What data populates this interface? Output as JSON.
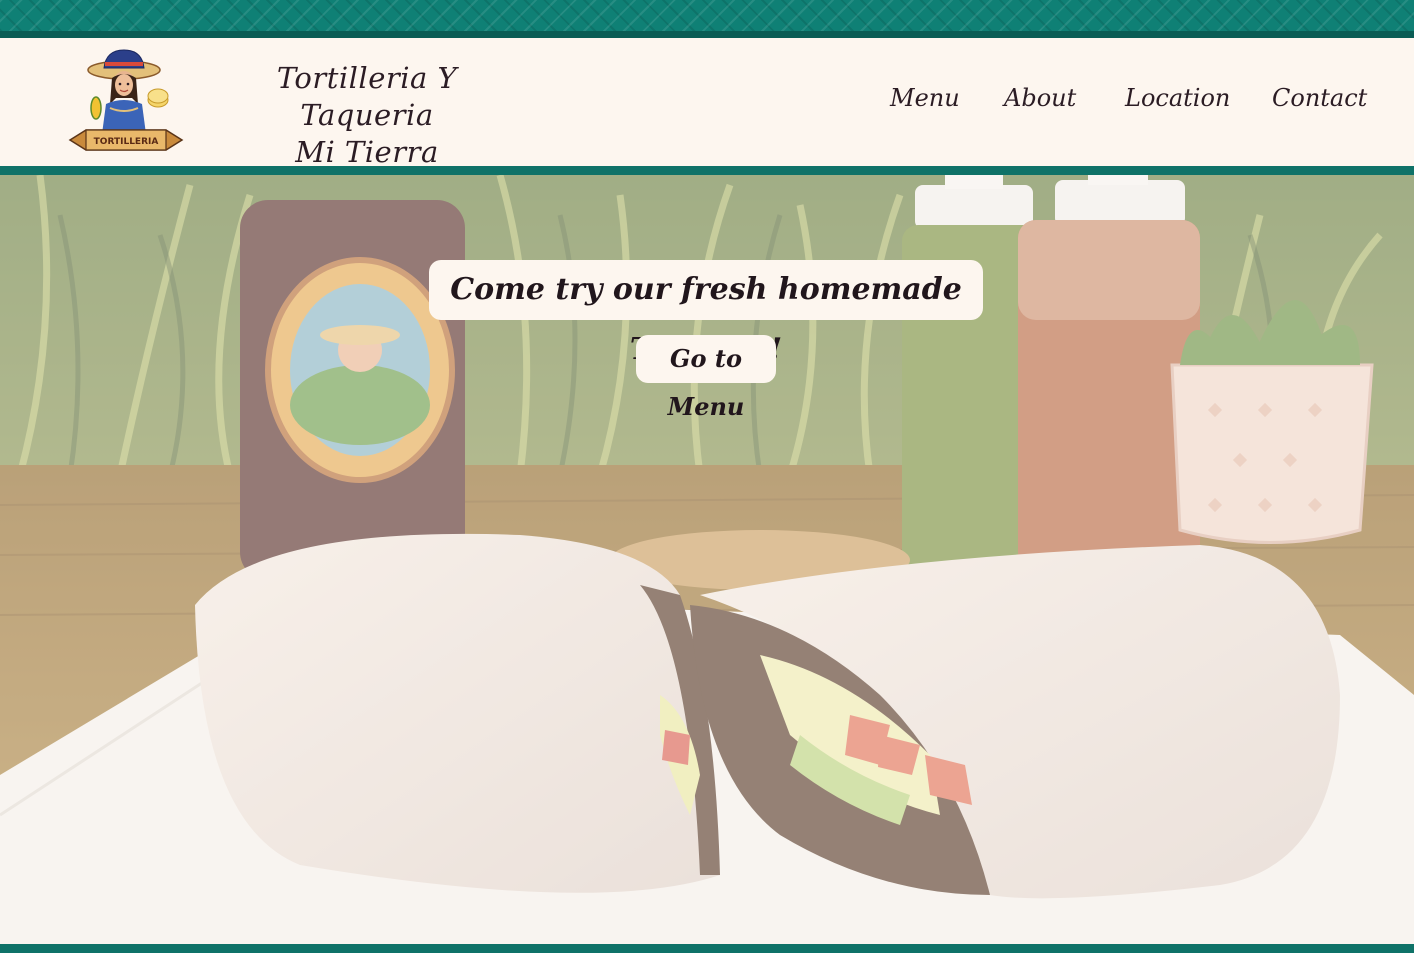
{
  "brand": {
    "line1": "Tortilleria Y Taqueria",
    "line2": "Mi Tierra",
    "logo_text": "TORTILLERIA"
  },
  "nav": {
    "items": [
      "Menu",
      "About",
      "Location",
      "Contact"
    ]
  },
  "hero": {
    "tagline": "Come try our fresh homemade Tortillas!",
    "button_label": "Go to Menu"
  },
  "colors": {
    "teal": "#0f8075",
    "teal_dark": "#0a5d55",
    "cream": "#fdf6ef",
    "text": "#2b1c24"
  }
}
